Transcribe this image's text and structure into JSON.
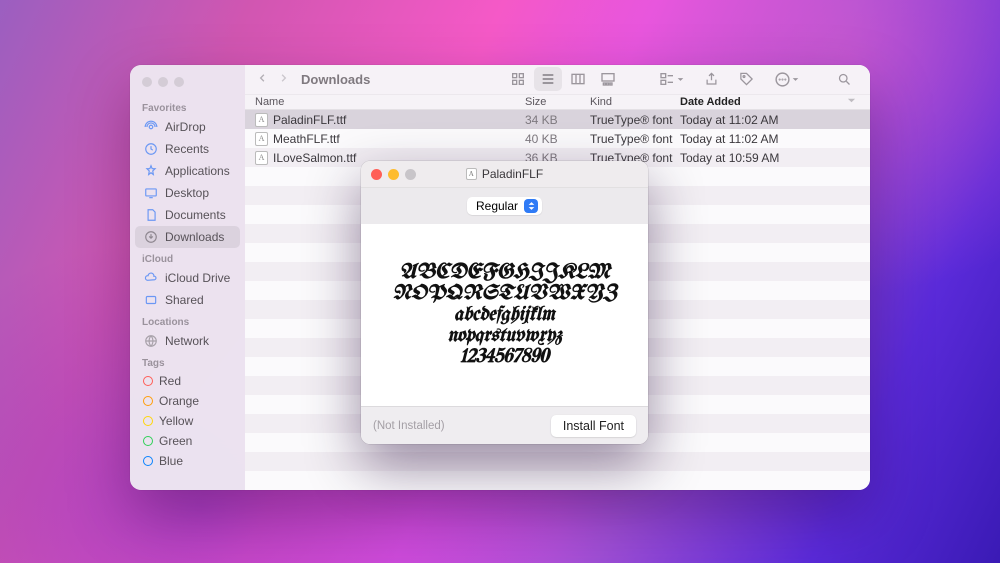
{
  "finder": {
    "title": "Downloads",
    "columns": {
      "name": "Name",
      "size": "Size",
      "kind": "Kind",
      "date": "Date Added"
    },
    "sidebar": {
      "sections": [
        {
          "label": "Favorites",
          "items": [
            {
              "icon": "airdrop-icon",
              "label": "AirDrop"
            },
            {
              "icon": "recents-icon",
              "label": "Recents"
            },
            {
              "icon": "applications-icon",
              "label": "Applications"
            },
            {
              "icon": "desktop-icon",
              "label": "Desktop"
            },
            {
              "icon": "documents-icon",
              "label": "Documents"
            },
            {
              "icon": "downloads-icon",
              "label": "Downloads",
              "selected": true
            }
          ]
        },
        {
          "label": "iCloud",
          "items": [
            {
              "icon": "icloud-icon",
              "label": "iCloud Drive"
            },
            {
              "icon": "shared-icon",
              "label": "Shared"
            }
          ]
        },
        {
          "label": "Locations",
          "items": [
            {
              "icon": "network-icon",
              "label": "Network"
            }
          ]
        },
        {
          "label": "Tags",
          "tags": [
            {
              "color": "#ff5f57",
              "label": "Red"
            },
            {
              "color": "#ff9f0a",
              "label": "Orange"
            },
            {
              "color": "#ffd60a",
              "label": "Yellow"
            },
            {
              "color": "#30d158",
              "label": "Green"
            },
            {
              "color": "#0a84ff",
              "label": "Blue"
            }
          ]
        }
      ]
    },
    "files": [
      {
        "name": "PaladinFLF.ttf",
        "size": "34 KB",
        "kind": "TrueType® font",
        "date": "Today at 11:02 AM",
        "selected": true
      },
      {
        "name": "MeathFLF.ttf",
        "size": "40 KB",
        "kind": "TrueType® font",
        "date": "Today at 11:02 AM"
      },
      {
        "name": "ILoveSalmon.ttf",
        "size": "36 KB",
        "kind": "TrueType® font",
        "date": "Today at 10:59 AM"
      }
    ]
  },
  "preview": {
    "title": "PaladinFLF",
    "style": "Regular",
    "sample": {
      "upper1": "ABCDEFGHIJKLM",
      "upper2": "NOPQRSTUVWXYZ",
      "lower1": "abcdefghijklm",
      "lower2": "nopqrstuvwxyz",
      "nums": "1234567890"
    },
    "status": "(Not Installed)",
    "install_label": "Install Font"
  }
}
